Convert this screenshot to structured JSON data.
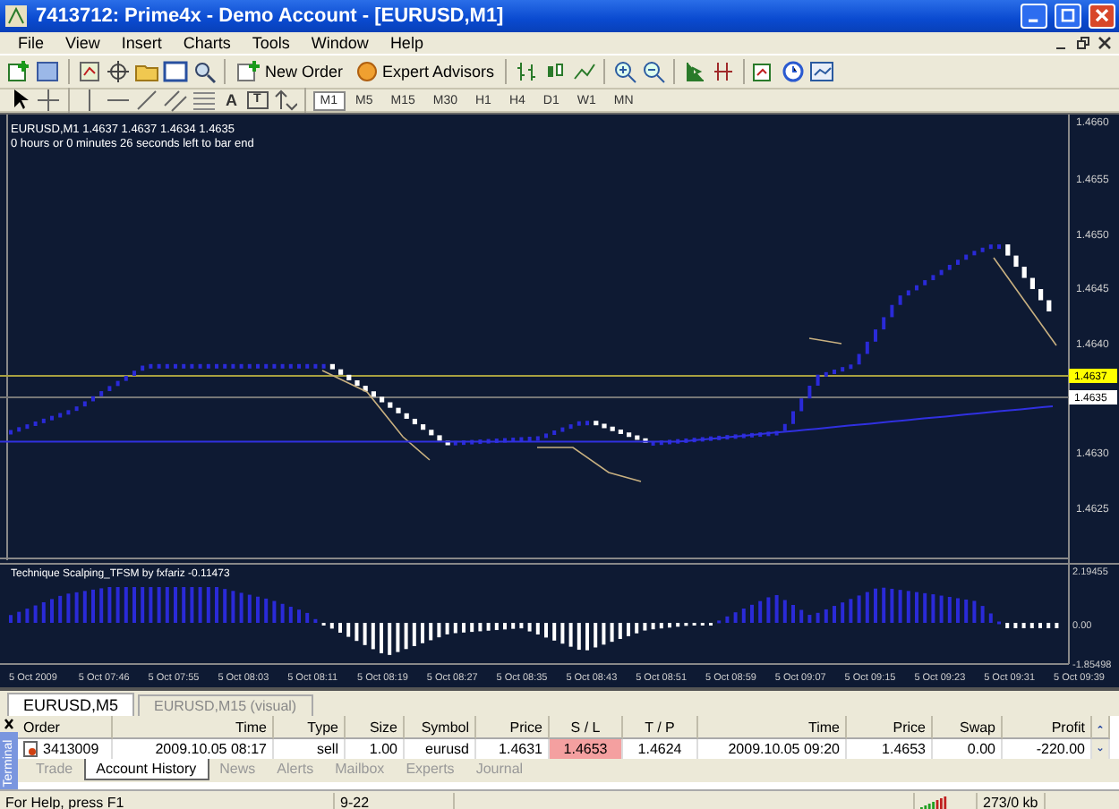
{
  "window": {
    "title": "7413712: Prime4x - Demo Account - [EURUSD,M1]"
  },
  "menu": {
    "items": [
      "File",
      "View",
      "Insert",
      "Charts",
      "Tools",
      "Window",
      "Help"
    ]
  },
  "toolbar": {
    "buttons": [
      {
        "label": "New Order"
      },
      {
        "label": "Expert Advisors"
      }
    ]
  },
  "drawing_toolbar": {
    "text_tools": [
      "A",
      "T"
    ],
    "timeframes": [
      {
        "label": "M1",
        "selected": true
      },
      {
        "label": "M5",
        "selected": false
      },
      {
        "label": "M15",
        "selected": false
      },
      {
        "label": "M30",
        "selected": false
      },
      {
        "label": "H1",
        "selected": false
      },
      {
        "label": "H4",
        "selected": false
      },
      {
        "label": "D1",
        "selected": false
      },
      {
        "label": "W1",
        "selected": false
      },
      {
        "label": "MN",
        "selected": false
      }
    ]
  },
  "chart": {
    "info_line": "EURUSD,M1  1.4637 1.4637 1.4634 1.4635",
    "countdown": "0 hours or 0 minutes 26 seconds left to bar end",
    "price_ticks": [
      "1.4660",
      "1.4655",
      "1.4650",
      "1.4645",
      "1.4640",
      "1.4630",
      "1.4625"
    ],
    "price_lines": [
      {
        "label": "1.4637",
        "color": "#ffff00"
      },
      {
        "label": "1.4635",
        "color": "#ffffff"
      }
    ],
    "indicator": {
      "title": "Technique Scalping_TFSM by fxfariz -0.11473",
      "ticks": [
        "2.19455",
        "0.00",
        "-1.85498"
      ]
    },
    "time_labels": [
      "5 Oct 2009",
      "5 Oct 07:46",
      "5 Oct 07:55",
      "5 Oct 08:03",
      "5 Oct 08:11",
      "5 Oct 08:19",
      "5 Oct 08:27",
      "5 Oct 08:35",
      "5 Oct 08:43",
      "5 Oct 08:51",
      "5 Oct 08:59",
      "5 Oct 09:07",
      "5 Oct 09:15",
      "5 Oct 09:23",
      "5 Oct 09:31",
      "5 Oct 09:39"
    ]
  },
  "chart_tabs": [
    {
      "label": "EURUSD,M5",
      "selected": true
    },
    {
      "label": "EURUSD,M15 (visual)",
      "selected": false
    }
  ],
  "terminal": {
    "side_label": "Terminal",
    "columns": [
      "Order",
      "Time",
      "Type",
      "Size",
      "Symbol",
      "Price",
      "S / L",
      "T / P",
      "Time",
      "Price",
      "Swap",
      "Profit"
    ],
    "rows": [
      {
        "cells": [
          {
            "text": "3413009",
            "highlighted": false
          },
          {
            "text": "2009.10.05 08:17",
            "highlighted": false
          },
          {
            "text": "sell",
            "highlighted": false
          },
          {
            "text": "1.00",
            "highlighted": false
          },
          {
            "text": "eurusd",
            "highlighted": false
          },
          {
            "text": "1.4631",
            "highlighted": false
          },
          {
            "text": "1.4653",
            "highlighted": true
          },
          {
            "text": "1.4624",
            "highlighted": false
          },
          {
            "text": "2009.10.05 09:20",
            "highlighted": false
          },
          {
            "text": "1.4653",
            "highlighted": false
          },
          {
            "text": "0.00",
            "highlighted": false
          },
          {
            "text": "-220.00",
            "highlighted": false
          }
        ]
      }
    ],
    "tabs": [
      {
        "label": "Trade",
        "selected": false
      },
      {
        "label": "Account History",
        "selected": true
      },
      {
        "label": "News",
        "selected": false
      },
      {
        "label": "Alerts",
        "selected": false
      },
      {
        "label": "Mailbox",
        "selected": false
      },
      {
        "label": "Experts",
        "selected": false
      },
      {
        "label": "Journal",
        "selected": false
      }
    ]
  },
  "status_bar": {
    "help": "For Help, press F1",
    "profile": "9-22",
    "traffic": "273/0 kb"
  }
}
